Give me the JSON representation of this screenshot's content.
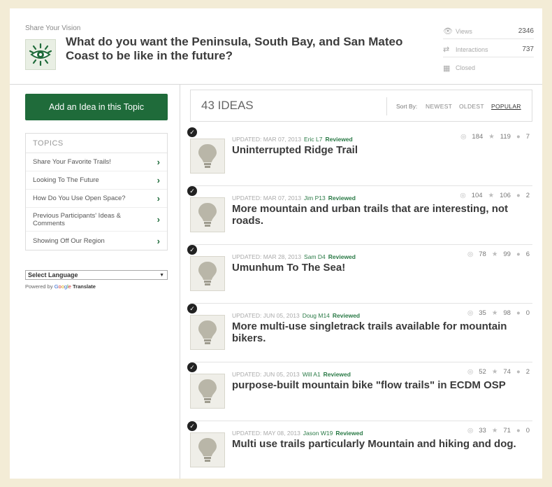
{
  "header": {
    "kicker": "Share Your Vision",
    "question": "What do you want the Peninsula, South Bay, and San Mateo Coast to be like in the future?",
    "stats": [
      {
        "icon": "eye-icon",
        "label": "Views",
        "value": "2346"
      },
      {
        "icon": "interactions-icon",
        "label": "Interactions",
        "value": "737"
      },
      {
        "icon": "calendar-icon",
        "label": "Closed",
        "value": ""
      }
    ]
  },
  "sidebar": {
    "add_button": "Add an Idea in this Topic",
    "topics_heading": "TOPICS",
    "topics": [
      {
        "label": "Share Your Favorite Trails!"
      },
      {
        "label": "Looking To The Future"
      },
      {
        "label": "How Do You Use Open Space?"
      },
      {
        "label": "Previous Participants' Ideas & Comments"
      },
      {
        "label": "Showing Off Our Region"
      }
    ],
    "language_select": "Select Language",
    "powered_by": "Powered by",
    "google": [
      "G",
      "o",
      "o",
      "g",
      "l",
      "e"
    ],
    "translate": "Translate"
  },
  "ideas": {
    "count": "43 IDEAS",
    "sort_by": "Sort By:",
    "sort_options": [
      "NEWEST",
      "OLDEST",
      "POPULAR"
    ],
    "active_sort": "POPULAR",
    "items": [
      {
        "updated": "UPDATED: MAR 07, 2013",
        "author": "Eric L7",
        "status": "Reviewed",
        "title": "Uninterrupted Ridge Trail",
        "views": "184",
        "stars": "119",
        "comments": "7"
      },
      {
        "updated": "UPDATED: MAR 07, 2013",
        "author": "Jim P13",
        "status": "Reviewed",
        "title": "More mountain and urban trails that are interesting, not roads.",
        "views": "104",
        "stars": "106",
        "comments": "2"
      },
      {
        "updated": "UPDATED: MAR 28, 2013",
        "author": "Sam D4",
        "status": "Reviewed",
        "title": "Umunhum To The Sea!",
        "views": "78",
        "stars": "99",
        "comments": "6"
      },
      {
        "updated": "UPDATED: JUN 05, 2013",
        "author": "Doug M14",
        "status": "Reviewed",
        "title": "More multi-use singletrack trails available for mountain bikers.",
        "views": "35",
        "stars": "98",
        "comments": "0"
      },
      {
        "updated": "UPDATED: JUN 05, 2013",
        "author": "Will A1",
        "status": "Reviewed",
        "title": "purpose-built mountain bike \"flow trails\" in ECDM OSP",
        "views": "52",
        "stars": "74",
        "comments": "2"
      },
      {
        "updated": "UPDATED: MAY 08, 2013",
        "author": "Jason W19",
        "status": "Reviewed",
        "title": "Multi use trails particularly Mountain and hiking and dog.",
        "views": "33",
        "stars": "71",
        "comments": "0"
      }
    ]
  },
  "colors": {
    "accent": "#1f6b3a",
    "background": "#f3ecd6"
  }
}
